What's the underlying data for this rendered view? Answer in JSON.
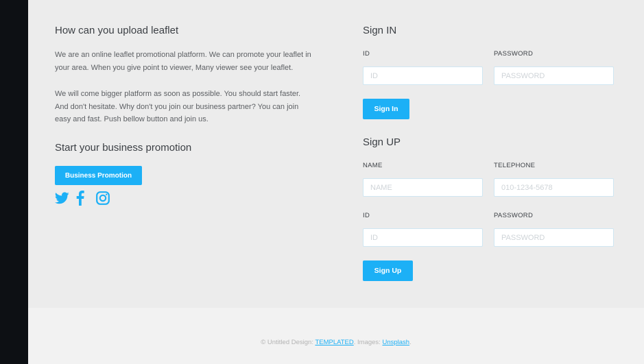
{
  "info": {
    "title": "How can you upload leaflet",
    "paragraph1": "We are an online leaflet promotional platform. We can promote your leaflet in your area. When you give point to viewer, Many viewer see your leaflet.",
    "paragraph2": "We will come bigger platform as soon as possible. You should start faster. And don't hesitate. Why don't you join our business partner? You can join easy and fast. Push bellow button and join us.",
    "promo_title": "Start your business promotion",
    "promo_button": "Business Promotion",
    "socials": [
      "twitter-icon",
      "facebook-icon",
      "instagram-icon"
    ],
    "accent_color": "#1cb0f6"
  },
  "signin": {
    "title": "Sign IN",
    "id_label": "ID",
    "id_placeholder": "ID",
    "password_label": "PASSWORD",
    "password_placeholder": "PASSWORD",
    "button": "Sign In"
  },
  "signup": {
    "title": "Sign UP",
    "name_label": "NAME",
    "name_placeholder": "NAME",
    "telephone_label": "TELEPHONE",
    "telephone_placeholder": "010-1234-5678",
    "id_label": "ID",
    "id_placeholder": "ID",
    "password_label": "PASSWORD",
    "password_placeholder": "PASSWORD",
    "button": "Sign Up"
  },
  "footer": {
    "prefix": "© Untitled Design: ",
    "templated_link": "TEMPLATED",
    "middle": ". Images: ",
    "unsplash_link": "Unsplash",
    "suffix": "."
  }
}
